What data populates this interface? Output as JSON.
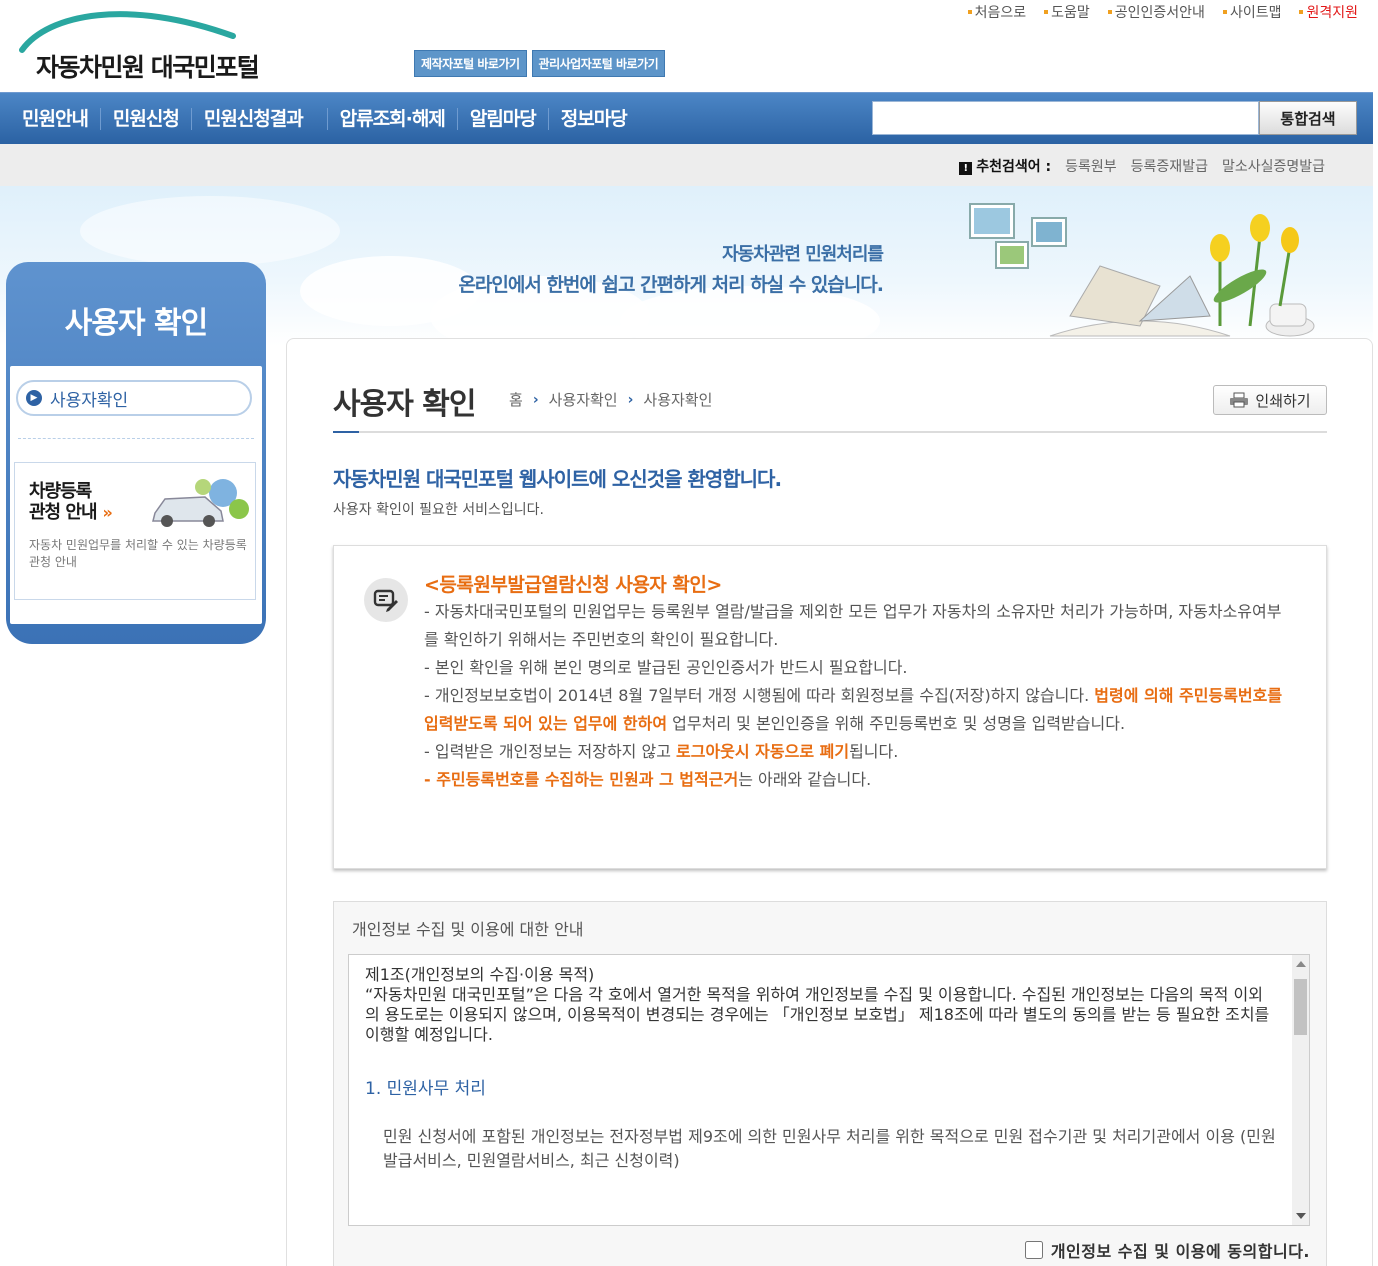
{
  "header": {
    "logo_text": "자동차민원 대국민포털",
    "util_links": [
      "처음으로",
      "도움말",
      "공인인증서안내",
      "사이트맵",
      "원격지원"
    ],
    "portal_buttons": [
      "제작자포털 바로가기",
      "관리사업자포털 바로가기"
    ]
  },
  "gnb": {
    "menu": [
      "민원안내",
      "민원신청",
      "민원신청결과",
      "압류조회·해제",
      "알림마당",
      "정보마당"
    ],
    "search_button": "통합검색",
    "search_value": ""
  },
  "recommend": {
    "label": "추천검색어 :",
    "keywords": [
      "등록원부",
      "등록증재발급",
      "말소사실증명발급"
    ]
  },
  "banner": {
    "line1": "자동차관련 민원처리를",
    "line2": "온라인에서 한번에 쉽고 간편하게 처리 하실 수 있습니다."
  },
  "lnb": {
    "title": "사용자 확인",
    "item": "사용자확인",
    "card_title_1": "차량등록",
    "card_title_2": "관청 안내",
    "card_arrow": "»",
    "card_desc": "자동차 민원업무를 처리할 수 있는 차량등록관청 안내"
  },
  "content": {
    "title": "사용자 확인",
    "breadcrumb": [
      "홈",
      "사용자확인",
      "사용자확인"
    ],
    "print_label": "인쇄하기",
    "welcome": "자동차민원 대국민포털 웹사이트에 오신것을 환영합니다.",
    "welcome_sub": "사용자 확인이 필요한 서비스입니다."
  },
  "notice": {
    "title": "<등록원부발급열람신청 사용자 확인>",
    "p1": "- 자동차대국민포털의 민원업무는 등록원부 열람/발급을 제외한 모든 업무가 자동차의 소유자만 처리가 가능하며, 자동차소유여부를 확인하기 위해서는 주민번호의 확인이 필요합니다.",
    "p2": "- 본인 확인을 위해 본인 명의로 발급된 공인인증서가 반드시 필요합니다.",
    "p3_a": "- 개인정보보호법이 2014년 8월 7일부터 개정 시행됨에 따라 회원정보를 수집(저장)하지 않습니다. ",
    "p3_hl": "법령에 의해 주민등록번호를 입력받도록 되어 있는 업무에 한하여",
    "p3_b": " 업무처리 및 본인인증을 위해 주민등록번호 및 성명을 입력받습니다.",
    "p4_a": "- 입력받은 개인정보는 저장하지 않고 ",
    "p4_hl": "로그아웃시 자동으로 폐기",
    "p4_b": "됩니다.",
    "p5_hl": "- 주민등록번호를 수집하는 민원과 그 법적근거",
    "p5_b": "는 아래와 같습니다."
  },
  "privacy": {
    "heading": "개인정보 수집 및 이용에 대한 안내",
    "article_title": "제1조(개인정보의 수집·이용 목적)",
    "article_body": "“자동차민원 대국민포털”은 다음 각 호에서 열거한 목적을 위하여 개인정보를 수집 및 이용합니다. 수집된 개인정보는 다음의 목적 이외의 용도로는 이용되지 않으며, 이용목적이 변경되는 경우에는 「개인정보 보호법」 제18조에 따라 별도의 동의를 받는 등 필요한 조치를 이행할 예정입니다.",
    "section1_title": "1. 민원사무 처리",
    "section1_body": "민원 신청서에 포함된 개인정보는 전자정부법 제9조에 의한 민원사무 처리를 위한 목적으로 민원 접수기관 및 처리기관에서 이용 (민원발급서비스, 민원열람서비스, 최근 신청이력)",
    "agree_label": "개인정보 수집 및 이용에 동의합니다."
  },
  "colors": {
    "primary": "#2e62a4",
    "accent": "#e86d12",
    "gnb": "#3a70b3"
  }
}
